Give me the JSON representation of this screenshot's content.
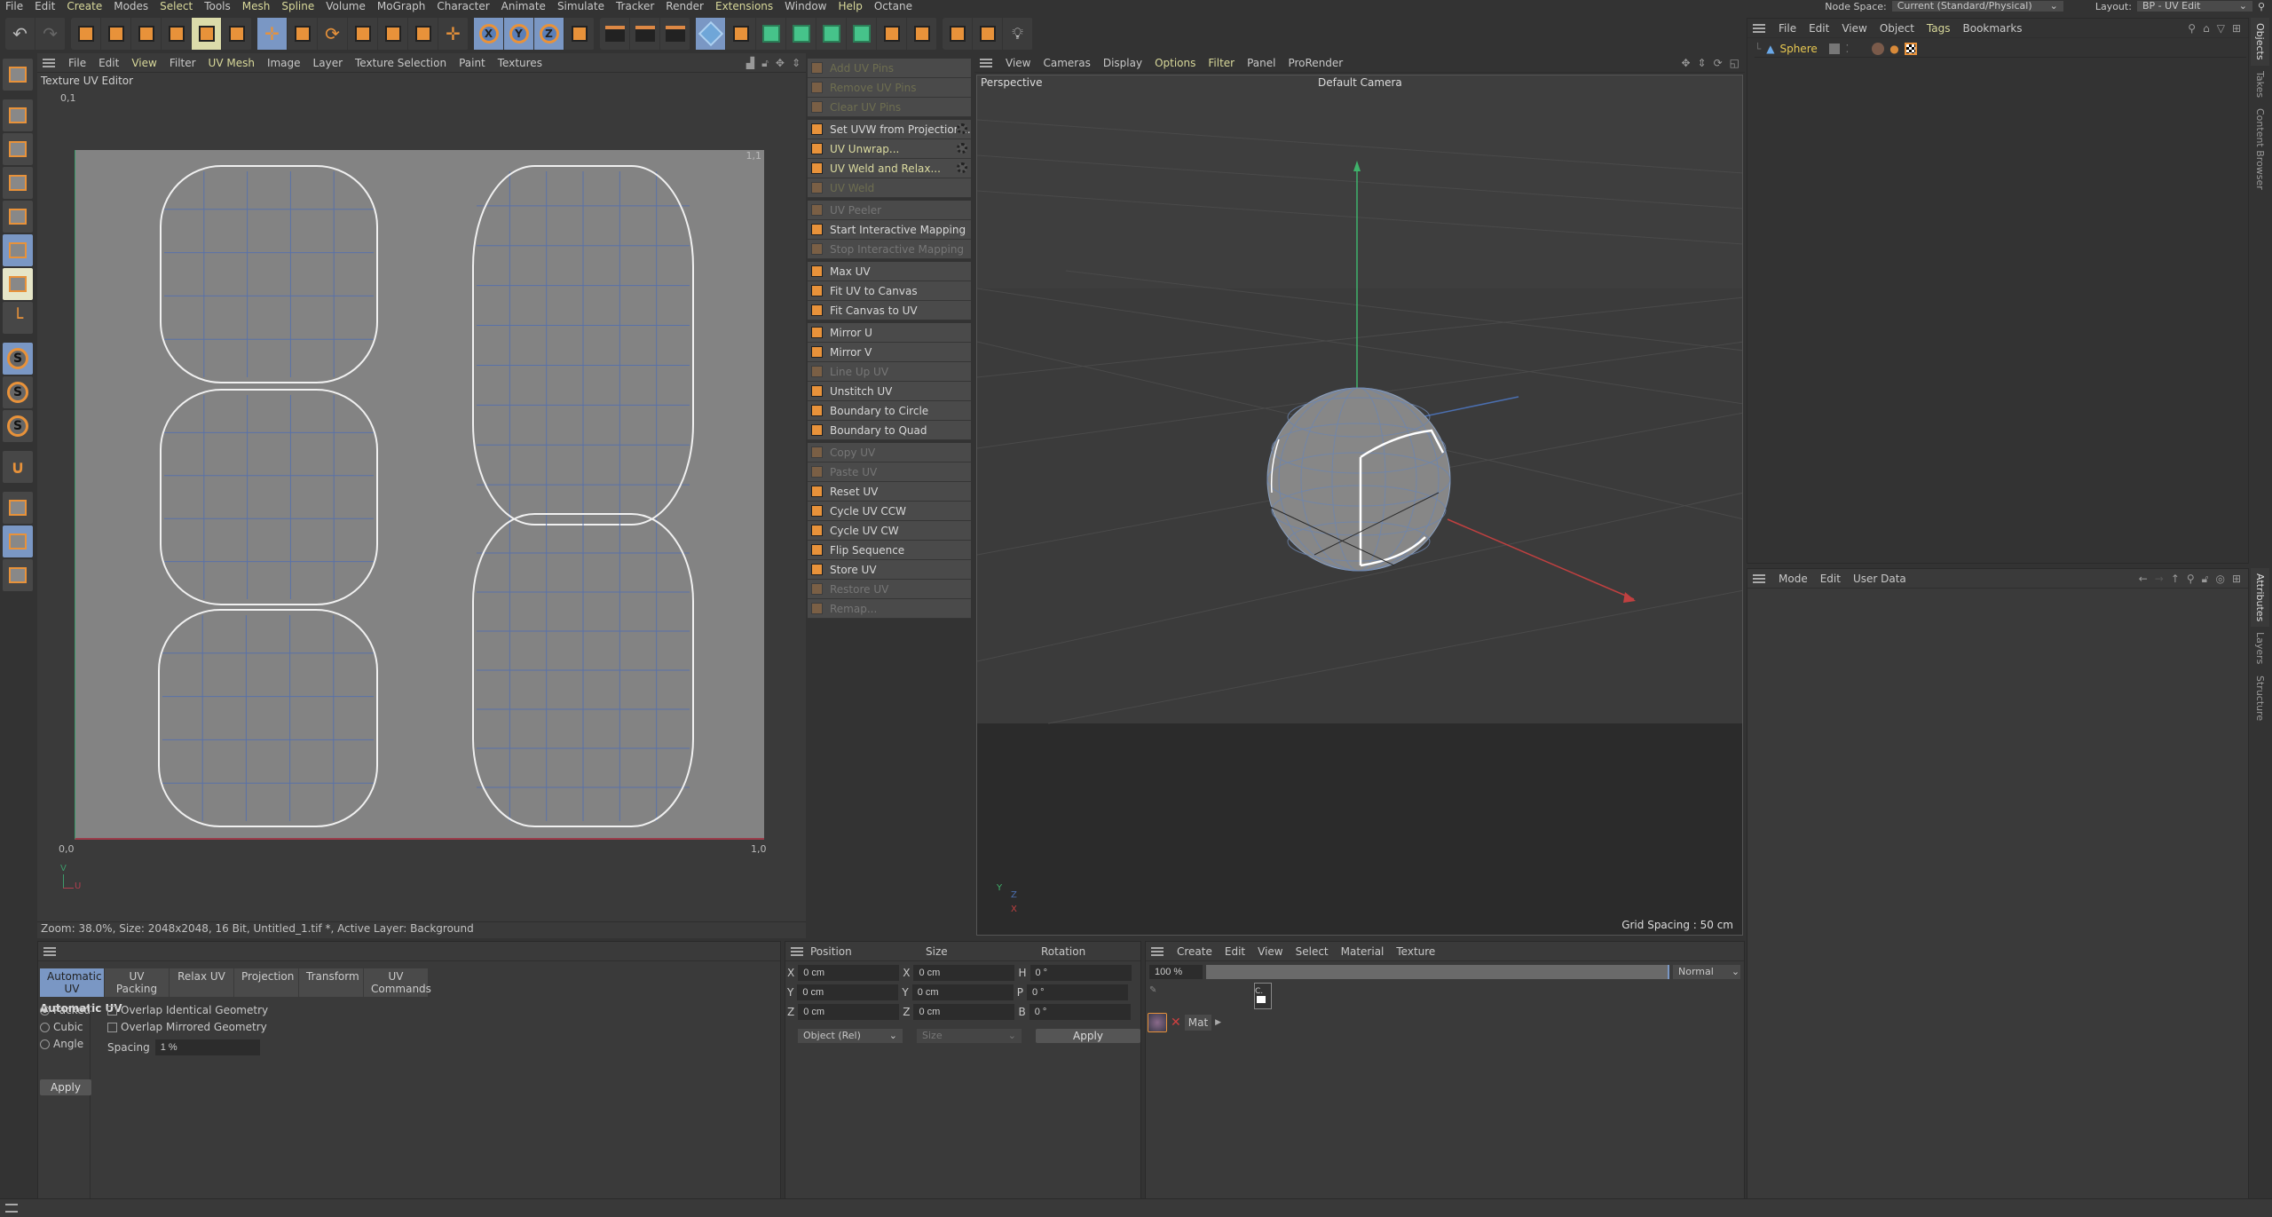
{
  "menubar": {
    "items": [
      {
        "label": "File",
        "hl": false
      },
      {
        "label": "Edit",
        "hl": false
      },
      {
        "label": "Create",
        "hl": true
      },
      {
        "label": "Modes",
        "hl": false
      },
      {
        "label": "Select",
        "hl": true
      },
      {
        "label": "Tools",
        "hl": false
      },
      {
        "label": "Mesh",
        "hl": true
      },
      {
        "label": "Spline",
        "hl": true
      },
      {
        "label": "Volume",
        "hl": false
      },
      {
        "label": "MoGraph",
        "hl": false
      },
      {
        "label": "Character",
        "hl": false
      },
      {
        "label": "Animate",
        "hl": false
      },
      {
        "label": "Simulate",
        "hl": false
      },
      {
        "label": "Tracker",
        "hl": false
      },
      {
        "label": "Render",
        "hl": false
      },
      {
        "label": "Extensions",
        "hl": true
      },
      {
        "label": "Window",
        "hl": false
      },
      {
        "label": "Help",
        "hl": true
      },
      {
        "label": "Octane",
        "hl": false
      }
    ],
    "node_space_label": "Node Space:",
    "node_space_value": "Current (Standard/Physical)",
    "layout_label": "Layout:",
    "layout_value": "BP - UV Edit"
  },
  "toolbar": {
    "groups": [
      [
        "undo-icon",
        "redo-icon"
      ],
      [
        "live-selection-icon",
        "selection-filter-icon",
        "uv-transform-icon",
        "uv-mode-icon",
        "uv-snap-settings-icon",
        "uv-grid-icon"
      ],
      [
        "move-icon",
        "scale-icon",
        "rotate-icon",
        "texture-placement-icon",
        "uv-grid-snap-icon",
        "psr-reset-icon",
        "axis-icon"
      ],
      [
        "x-axis-lock-icon",
        "y-axis-lock-icon",
        "z-axis-lock-icon",
        "coordinate-system-icon"
      ],
      [
        "render-view-icon",
        "render-picture-viewer-icon",
        "render-settings-icon"
      ],
      [
        "cube-icon",
        "pen-icon",
        "subdivision-icon",
        "extrude-icon",
        "cloner-icon",
        "array-icon",
        "symmetry-icon",
        "deformer-icon"
      ],
      [
        "floor-icon",
        "camera-icon",
        "light-icon"
      ]
    ]
  },
  "lefttools": [
    "make-editable-icon",
    "model-mode-icon",
    "texture-mode-icon",
    "points-mode-icon",
    "edges-mode-icon",
    "polygons-mode-icon",
    "uv-polygons-mode-icon",
    "axis-mode-icon",
    "solo-icon",
    "solo-hierarchy-icon",
    "solo-off-icon",
    "snap-icon",
    "workplane-icon",
    "locked-workplane-icon",
    "align-workplane-icon"
  ],
  "uv_editor": {
    "menu": [
      {
        "label": "File",
        "hl": false
      },
      {
        "label": "Edit",
        "hl": false
      },
      {
        "label": "View",
        "hl": true
      },
      {
        "label": "Filter",
        "hl": false
      },
      {
        "label": "UV Mesh",
        "hl": true
      },
      {
        "label": "Image",
        "hl": false
      },
      {
        "label": "Layer",
        "hl": false
      },
      {
        "label": "Texture Selection",
        "hl": false
      },
      {
        "label": "Paint",
        "hl": false
      },
      {
        "label": "Textures",
        "hl": false
      }
    ],
    "title": "Texture UV Editor",
    "corner_tl": "0,1",
    "corner_tr": "1,1",
    "corner_bl": "0,0",
    "corner_br": "1,0",
    "axis_v": "V",
    "axis_u": "U",
    "status": "Zoom: 38.0%, Size: 2048x2048, 16 Bit, Untitled_1.tif *, Active Layer: Background"
  },
  "uv_commands": {
    "groups": [
      [
        {
          "label": "Add UV Pins",
          "disabled": true,
          "yellow": true
        },
        {
          "label": "Remove UV Pins",
          "disabled": true,
          "yellow": true
        },
        {
          "label": "Clear UV Pins",
          "disabled": true,
          "yellow": true
        }
      ],
      [
        {
          "label": "Set UVW from Projection...",
          "gear": true
        },
        {
          "label": "UV Unwrap...",
          "gear": true,
          "yellow": true
        },
        {
          "label": "UV Weld and Relax...",
          "gear": true,
          "yellow": true
        },
        {
          "label": "UV Weld",
          "disabled": true,
          "yellow": true
        }
      ],
      [
        {
          "label": "UV Peeler",
          "disabled": true
        },
        {
          "label": "Start Interactive Mapping"
        },
        {
          "label": "Stop Interactive Mapping",
          "disabled": true
        }
      ],
      [
        {
          "label": "Max UV"
        },
        {
          "label": "Fit UV to Canvas"
        },
        {
          "label": "Fit Canvas to UV"
        }
      ],
      [
        {
          "label": "Mirror U"
        },
        {
          "label": "Mirror V"
        },
        {
          "label": "Line Up UV",
          "disabled": true
        },
        {
          "label": "Unstitch UV"
        },
        {
          "label": "Boundary to Circle"
        },
        {
          "label": "Boundary to Quad"
        }
      ],
      [
        {
          "label": "Copy UV",
          "disabled": true
        },
        {
          "label": "Paste UV",
          "disabled": true
        },
        {
          "label": "Reset UV"
        },
        {
          "label": "Cycle UV CCW"
        },
        {
          "label": "Cycle UV CW"
        },
        {
          "label": "Flip Sequence"
        },
        {
          "label": "Store UV"
        },
        {
          "label": "Restore UV",
          "disabled": true
        },
        {
          "label": "Remap...",
          "disabled": true
        }
      ]
    ]
  },
  "viewport": {
    "menu": [
      {
        "label": "View",
        "hl": false
      },
      {
        "label": "Cameras",
        "hl": false
      },
      {
        "label": "Display",
        "hl": false
      },
      {
        "label": "Options",
        "hl": true
      },
      {
        "label": "Filter",
        "hl": true
      },
      {
        "label": "Panel",
        "hl": false
      },
      {
        "label": "ProRender",
        "hl": false
      }
    ],
    "view_name": "Perspective",
    "camera": "Default Camera",
    "grid_spacing": "Grid Spacing : 50 cm",
    "axis": {
      "y": "Y",
      "z": "Z",
      "x": "X"
    }
  },
  "objects": {
    "menu": [
      {
        "label": "File",
        "hl": false
      },
      {
        "label": "Edit",
        "hl": false
      },
      {
        "label": "View",
        "hl": false
      },
      {
        "label": "Object",
        "hl": false
      },
      {
        "label": "Tags",
        "hl": true
      },
      {
        "label": "Bookmarks",
        "hl": false
      }
    ],
    "items": [
      {
        "name": "Sphere"
      }
    ]
  },
  "attributes": {
    "menu": [
      "Mode",
      "Edit",
      "User Data"
    ]
  },
  "side_tabs_top": [
    {
      "label": "Objects",
      "active": true
    },
    {
      "label": "Takes",
      "active": false
    },
    {
      "label": "Content Browser",
      "active": false
    }
  ],
  "side_tabs_bottom": [
    {
      "label": "Attributes",
      "active": true
    },
    {
      "label": "Layers",
      "active": false
    },
    {
      "label": "Structure",
      "active": false
    }
  ],
  "auto_uv": {
    "tabs": [
      {
        "label": "Automatic UV",
        "active": true
      },
      {
        "label": "UV Packing"
      },
      {
        "label": "Relax UV"
      },
      {
        "label": "Projection"
      },
      {
        "label": "Transform"
      },
      {
        "label": "UV Commands"
      }
    ],
    "section_title": "Automatic UV",
    "modes": [
      {
        "label": "Packed",
        "checked": true
      },
      {
        "label": "Cubic",
        "checked": false
      },
      {
        "label": "Angle",
        "checked": false
      }
    ],
    "options": [
      {
        "label": "Overlap Identical Geometry",
        "checked": false
      },
      {
        "label": "Overlap Mirrored Geometry",
        "checked": false
      }
    ],
    "spacing_label": "Spacing",
    "spacing_value": "1 %",
    "apply_label": "Apply"
  },
  "coordinates": {
    "headers": [
      "Position",
      "Size",
      "Rotation"
    ],
    "rows": [
      [
        {
          "axis": "X",
          "value": "0 cm"
        },
        {
          "axis": "X",
          "value": "0 cm"
        },
        {
          "axis": "H",
          "value": "0 °"
        }
      ],
      [
        {
          "axis": "Y",
          "value": "0 cm"
        },
        {
          "axis": "Y",
          "value": "0 cm"
        },
        {
          "axis": "P",
          "value": "0 °"
        }
      ],
      [
        {
          "axis": "Z",
          "value": "0 cm"
        },
        {
          "axis": "Z",
          "value": "0 cm"
        },
        {
          "axis": "B",
          "value": "0 °"
        }
      ]
    ],
    "mode_value": "Object (Rel)",
    "size_value": "Size",
    "apply_label": "Apply"
  },
  "material": {
    "menu": [
      "Create",
      "Edit",
      "View",
      "Select",
      "Material",
      "Texture"
    ],
    "opacity": "100 %",
    "blend": "Normal",
    "layer_name": "Mat",
    "channel": "C."
  }
}
